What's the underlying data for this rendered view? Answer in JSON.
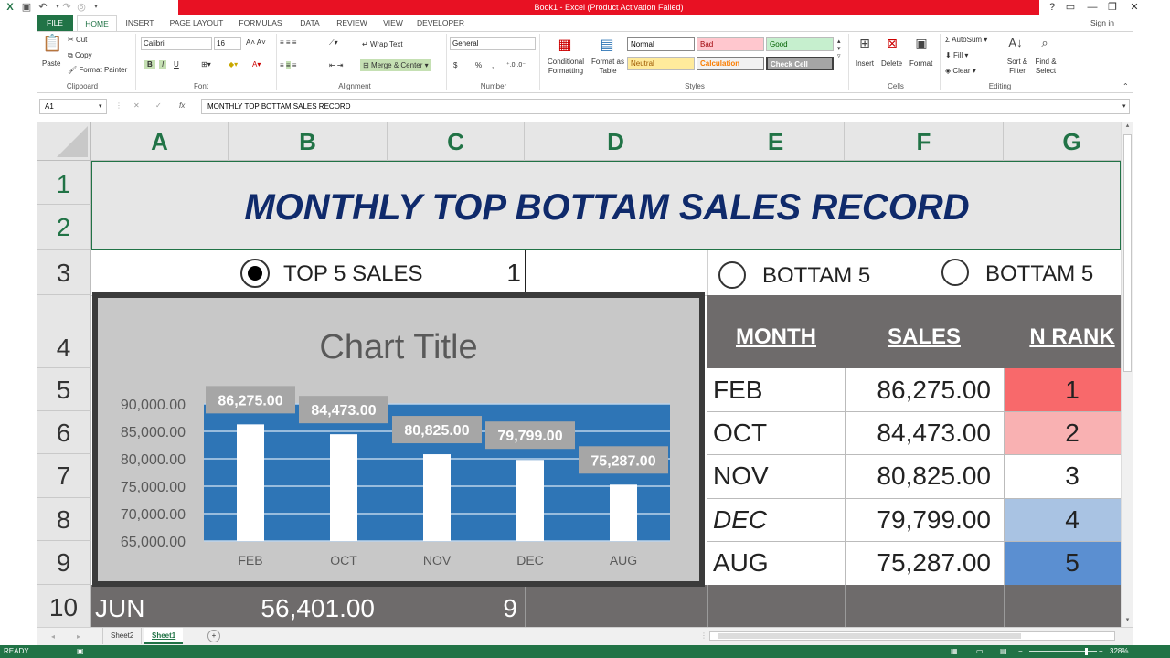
{
  "window": {
    "title": "Book1 - Excel (Product Activation Failed)",
    "controls": [
      "?",
      "▭",
      "—",
      "❐",
      "✕"
    ],
    "signin": "Sign in"
  },
  "ribbon_tabs": [
    "FILE",
    "HOME",
    "INSERT",
    "PAGE LAYOUT",
    "FORMULAS",
    "DATA",
    "REVIEW",
    "VIEW",
    "DEVELOPER"
  ],
  "clipboard": {
    "paste": "Paste",
    "cut": "Cut",
    "copy": "Copy",
    "format_painter": "Format Painter",
    "label": "Clipboard"
  },
  "font": {
    "name": "Calibri",
    "size": "16",
    "bold": "B",
    "italic": "I",
    "underline": "U",
    "label": "Font"
  },
  "alignment": {
    "wrap_text": "Wrap Text",
    "merge_center": "Merge & Center",
    "label": "Alignment"
  },
  "number": {
    "format": "General",
    "currency": "$",
    "percent": "%",
    "comma": ",",
    "label": "Number"
  },
  "styles": {
    "conditional": "Conditional Formatting",
    "format_table": "Format as Table",
    "normal": "Normal",
    "bad": "Bad",
    "good": "Good",
    "neutral": "Neutral",
    "calculation": "Calculation",
    "check_cell": "Check Cell",
    "label": "Styles"
  },
  "cells_group": {
    "insert": "Insert",
    "delete": "Delete",
    "format": "Format",
    "label": "Cells"
  },
  "editing": {
    "autosum": "AutoSum",
    "fill": "Fill",
    "clear": "Clear",
    "sort_filter": "Sort & Filter",
    "find_select": "Find & Select",
    "label": "Editing"
  },
  "formula_bar": {
    "name_box": "A1",
    "fx": "fx",
    "cancel": "✕",
    "enter": "✓",
    "content": "MONTHLY TOP BOTTAM SALES RECORD"
  },
  "columns": [
    "A",
    "B",
    "C",
    "D",
    "E",
    "F",
    "G"
  ],
  "rows": [
    "1",
    "2",
    "3",
    "4",
    "5",
    "6",
    "7",
    "8",
    "9",
    "10"
  ],
  "sheet": {
    "title": "MONTHLY TOP BOTTAM SALES RECORD",
    "option_top": "TOP 5 SALES",
    "option_top_value": "1",
    "option_bottom_1": "BOTTAM 5",
    "option_bottom_2": "BOTTAM 5",
    "headers": {
      "month": "MONTH",
      "sales": "SALES",
      "rank": "N RANK"
    },
    "table": [
      {
        "month": "FEB",
        "sales": "86,275.00",
        "rank": "1",
        "rank_color": "#f8696b",
        "italic": false
      },
      {
        "month": "OCT",
        "sales": "84,473.00",
        "rank": "2",
        "rank_color": "#f9b1b2",
        "italic": false
      },
      {
        "month": "NOV",
        "sales": "80,825.00",
        "rank": "3",
        "rank_color": "#ffffff",
        "italic": false
      },
      {
        "month": "DEC",
        "sales": "79,799.00",
        "rank": "4",
        "rank_color": "#a9c3e3",
        "italic": true
      },
      {
        "month": "AUG",
        "sales": "75,287.00",
        "rank": "5",
        "rank_color": "#5b8fd1",
        "italic": false
      }
    ],
    "row10": {
      "month": "JUN",
      "sales": "56,401.00",
      "rank": "9"
    }
  },
  "chart_data": {
    "type": "bar",
    "title": "Chart Title",
    "categories": [
      "FEB",
      "OCT",
      "NOV",
      "DEC",
      "AUG"
    ],
    "values": [
      86275.0,
      84473.0,
      80825.0,
      79799.0,
      75287.0
    ],
    "data_labels": [
      "86,275.00",
      "84,473.00",
      "80,825.00",
      "79,799.00",
      "75,287.00"
    ],
    "y_ticks": [
      "90,000.00",
      "85,000.00",
      "80,000.00",
      "75,000.00",
      "70,000.00",
      "65,000.00"
    ],
    "ylim": [
      65000,
      90000
    ],
    "grid": true,
    "bar_color": "#ffffff",
    "plot_bg": "#2e75b6"
  },
  "sheet_tabs": [
    "Sheet2",
    "Sheet1"
  ],
  "active_sheet": "Sheet1",
  "status": {
    "ready": "READY",
    "zoom": "328%"
  },
  "colors": {
    "excel_green": "#217346",
    "title_blue": "#0f2a6b",
    "header_gray": "#6e6b6b"
  }
}
